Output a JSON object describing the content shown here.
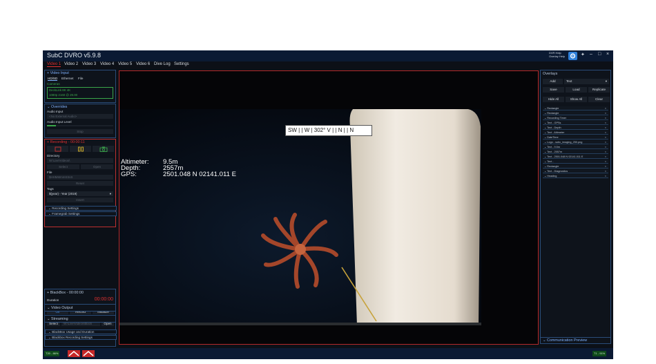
{
  "app": {
    "title": "SubC DVRO v5.9.8",
    "help_links": [
      "DVR Help",
      "Overlay Help"
    ],
    "settings_icon": "gear-icon",
    "window_buttons": [
      "pin",
      "–",
      "□",
      "×"
    ]
  },
  "menu": [
    "Video 1",
    "Video 2",
    "Video 3",
    "Video 4",
    "Video 5",
    "Video 6",
    "Dive Log",
    "Settings"
  ],
  "video_input": {
    "header": "Video Input",
    "tabs": [
      "HD/SD",
      "Ethernet",
      "File"
    ],
    "camera_label": "Cameras",
    "cameras": [
      "DeckLink 8K 4K",
      "1080p 2160 @ 29.00"
    ]
  },
  "overrides": {
    "header": "Overrides",
    "audio_input_label": "Audio Input",
    "audio_input_value": "<No External Audio>",
    "audio_level_label": "Audio Input Level",
    "stop_label": "Stop"
  },
  "recording": {
    "header": "Recording - 00:00:11",
    "directory_label": "Directory",
    "directory_value": "W:\\Live\\Videos\\",
    "select_label": "Select",
    "open_label": "Open",
    "file_label": "File",
    "file_value": "$HHMMmmSSsS",
    "reset_label": "Reset",
    "tags_label": "Tags",
    "tags_value": "$(year) - Year (2019)",
    "insert_label": "Insert",
    "settings_bar": "Recording Settings",
    "framegrab_bar": "Framegrab Settings"
  },
  "blackbox": {
    "header": "BlackBox - 00:00:00",
    "duration_label": "Duration",
    "duration_value": "00:00:00",
    "trigger_label": "Trigger",
    "trigger_buttons": [
      "Off",
      "Record",
      "Initialize"
    ],
    "rec_dir_label": "Recording Directory",
    "select_label": "Select",
    "dir_value": "W:\\Live\\Videos\\Black",
    "open_label": "Open",
    "usage_bar": "BlackBox Usage and Duration",
    "rec_settings_bar": "Blackbox Recording Settings"
  },
  "video_output": {
    "header": "Video Output"
  },
  "streaming": {
    "header": "Streaming"
  },
  "overlay_text": {
    "altimeter_label": "Altimeter:",
    "altimeter_value": "9.5m",
    "depth_label": "Depth:",
    "depth_value": "2557m",
    "gps_label": "GPS:",
    "gps_value": "2501.048 N 02141.011 E",
    "heading_bar": "SW | | W | 302° V | | N | | N"
  },
  "overlays": {
    "header": "Overlays",
    "add_label": "Add",
    "type_value": "Text",
    "buttons_row1": [
      "Save",
      "Load",
      "Replicate"
    ],
    "buttons_row2": [
      "Hide All",
      "Show All",
      "Clear"
    ],
    "items": [
      "Rectangle",
      "Rectangle",
      "Recording Timer",
      "Text - GPSs",
      "Text - Depth",
      "Text - Altimeter",
      "DateTime",
      "Logo - subc_imaging_250.png",
      "Text - 9.5m",
      "Text - 2557m",
      "Text - 2501.048 N 02141.011 E",
      "Text -",
      "Rectangle",
      "Text - Diagnostics",
      "Heading"
    ]
  },
  "comm_preview": {
    "label": "Communication Preview"
  },
  "status": {
    "left_badge": "T20 - 86%",
    "right_badge": "T1 - 91%"
  },
  "colors": {
    "accent_blue": "#2f7fd8",
    "record_red": "#e03030",
    "frame_blue": "#2a4d7a"
  }
}
